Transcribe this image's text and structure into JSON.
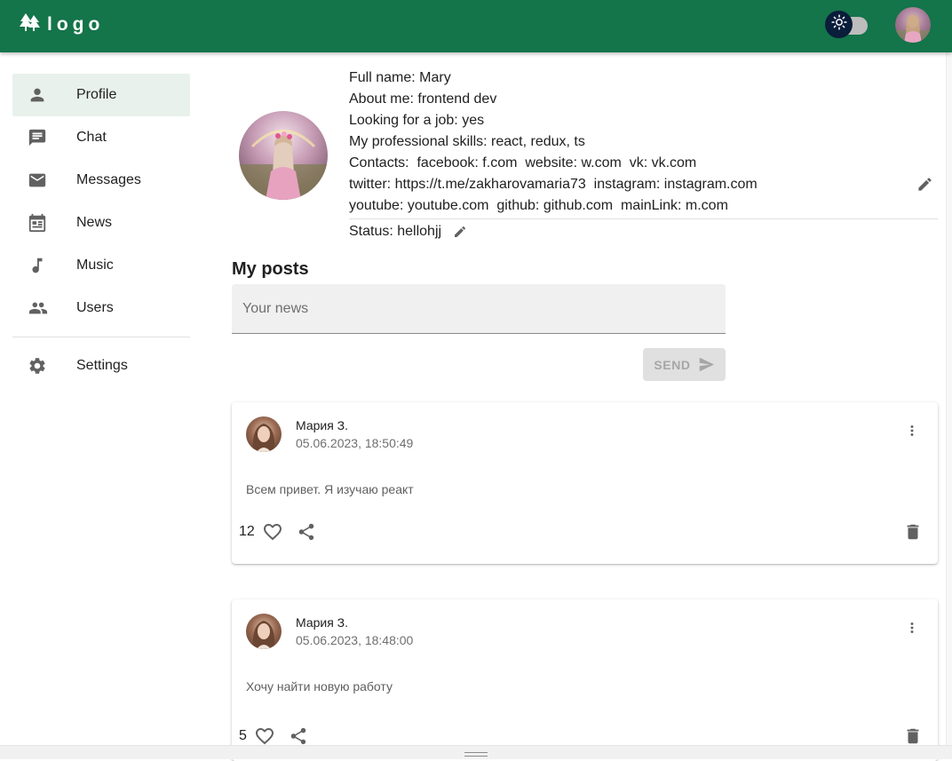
{
  "header": {
    "logo_text": "logo",
    "theme_toggle_icon": "sun-icon",
    "avatar_icon": "user-avatar",
    "colors": {
      "appbar": "#14744a",
      "toggle_thumb": "#0a1d3a"
    }
  },
  "sidebar": {
    "items": [
      {
        "label": "Profile",
        "icon": "person-icon",
        "active": true
      },
      {
        "label": "Chat",
        "icon": "chat-icon",
        "active": false
      },
      {
        "label": "Messages",
        "icon": "mail-icon",
        "active": false
      },
      {
        "label": "News",
        "icon": "calendar-icon",
        "active": false
      },
      {
        "label": "Music",
        "icon": "music-note-icon",
        "active": false
      },
      {
        "label": "Users",
        "icon": "people-icon",
        "active": false
      }
    ],
    "settings": {
      "label": "Settings",
      "icon": "gear-icon"
    }
  },
  "profile": {
    "full_name": "Full name: Mary",
    "about_me": "About me: frontend dev",
    "looking_for_job": "Looking for a job: yes",
    "skills": "My professional skills: react, redux, ts",
    "contacts_line1": "Contacts:  facebook: f.com  website: w.com  vk: vk.com",
    "contacts_line2": "twitter: https://t.me/zakharovamaria73  instagram: instagram.com",
    "contacts_line3": "youtube: youtube.com  github: github.com  mainLink: m.com",
    "status": "Status: hellohjj"
  },
  "posts_section": {
    "title": "My posts",
    "input_placeholder": "Your news",
    "send_label": "SEND"
  },
  "posts": [
    {
      "author": "Мария З.",
      "date": "05.06.2023, 18:50:49",
      "text": "Всем привет. Я изучаю реакт",
      "likes": "12"
    },
    {
      "author": "Мария З.",
      "date": "05.06.2023, 18:48:00",
      "text": "Хочу найти новую работу",
      "likes": "5"
    }
  ]
}
